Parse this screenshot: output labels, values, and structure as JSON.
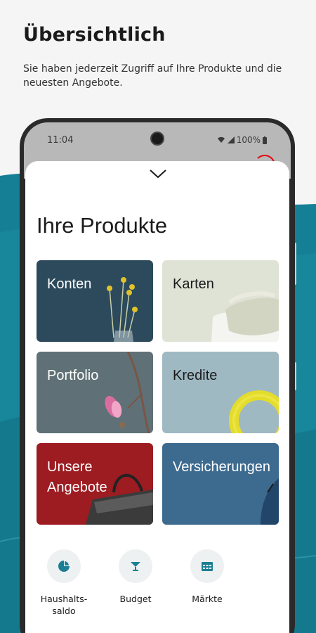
{
  "promo": {
    "title": "Übersichtlich",
    "subtitle": "Sie haben jederzeit Zugriff auf Ihre Produkte und die neuesten Angebote."
  },
  "status_bar": {
    "time": "11:04",
    "battery": "100%"
  },
  "screen": {
    "title": "Ihre Produkte",
    "tiles": [
      {
        "label": "Konten",
        "color": "#2c4a5c"
      },
      {
        "label": "Karten",
        "color": "#dfe3d5"
      },
      {
        "label": "Portfolio",
        "color": "#5f7176"
      },
      {
        "label": "Kredite",
        "color": "#9fb9c2"
      },
      {
        "label": "Unsere Angebote",
        "color": "#9c1c21"
      },
      {
        "label": "Versicherungen",
        "color": "#3d6a8f"
      }
    ],
    "quick_actions": [
      {
        "label": "Haushalts-saldo",
        "icon": "pie-chart-icon"
      },
      {
        "label": "Budget",
        "icon": "budget-glass-icon"
      },
      {
        "label": "Märkte",
        "icon": "calendar-grid-icon"
      }
    ]
  },
  "colors": {
    "accent_teal": "#157f95",
    "brand_red": "#e30613",
    "icon_teal": "#1c7f93"
  }
}
